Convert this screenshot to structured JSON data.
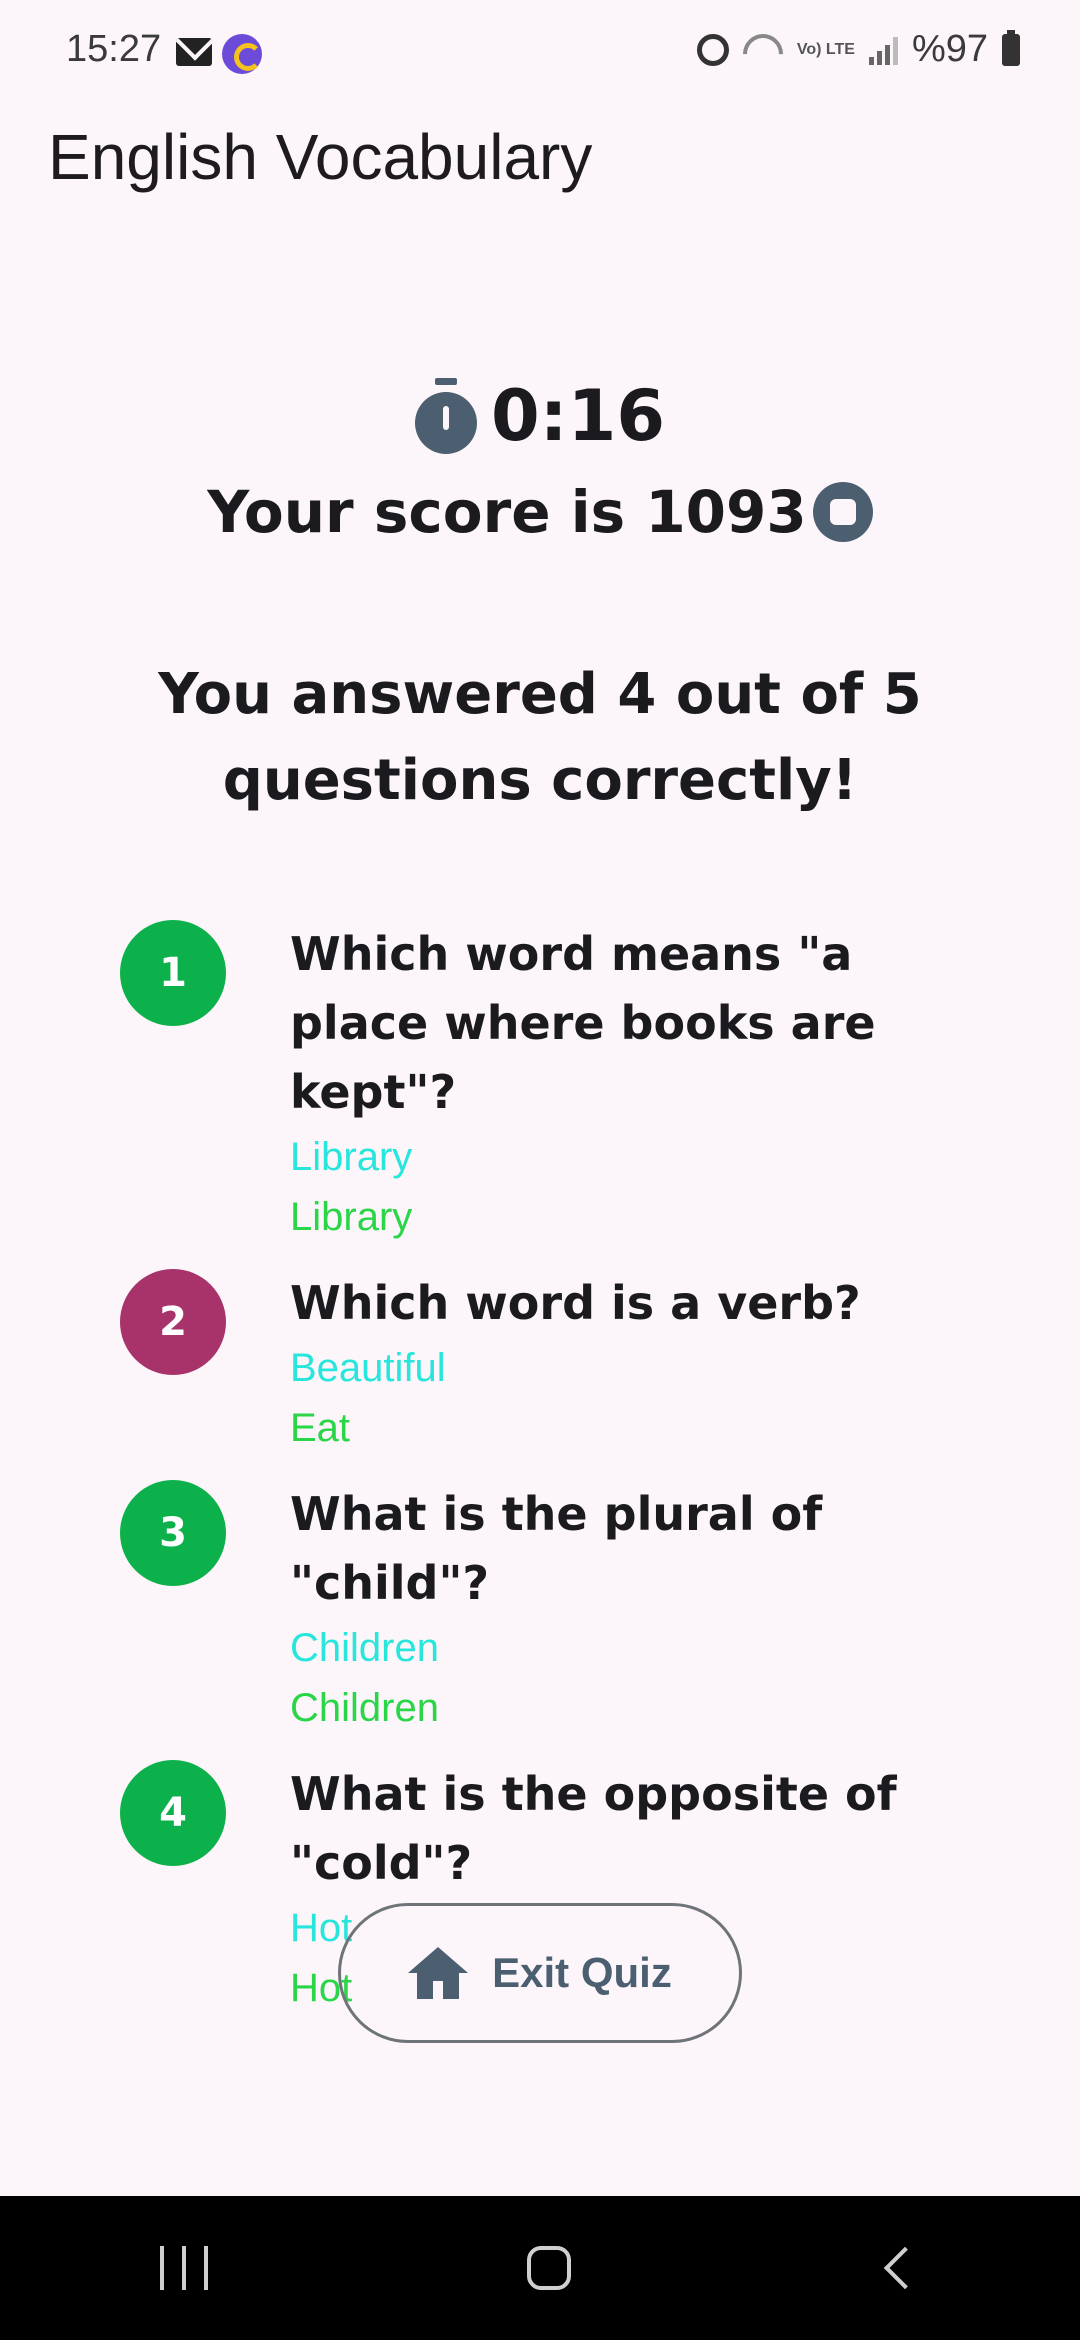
{
  "status_bar": {
    "time": "15:27",
    "network_label": "Vo) LTE",
    "battery": "%97"
  },
  "app": {
    "title": "English Vocabulary"
  },
  "quiz_result": {
    "timer": "0:16",
    "score_text": "Your score is 1093",
    "summary": "You answered 4 out of 5 questions correctly!",
    "colors": {
      "correct": "#0db14b",
      "wrong": "#a8336a",
      "selected_answer": "#28e6dc",
      "correct_answer": "#2ad548"
    },
    "questions": [
      {
        "number": "1",
        "question": "Which word means \"a place where books are kept\"?",
        "your_answer": "Library",
        "correct_answer": "Library",
        "status": "correct"
      },
      {
        "number": "2",
        "question": "Which word is a verb?",
        "your_answer": "Beautiful",
        "correct_answer": "Eat",
        "status": "wrong"
      },
      {
        "number": "3",
        "question": "What is the plural of \"child\"?",
        "your_answer": "Children",
        "correct_answer": "Children",
        "status": "correct"
      },
      {
        "number": "4",
        "question": "What is the opposite of \"cold\"?",
        "your_answer": "Hot",
        "correct_answer": "Hot",
        "status": "correct"
      }
    ],
    "exit_button_label": "Exit Quiz"
  }
}
